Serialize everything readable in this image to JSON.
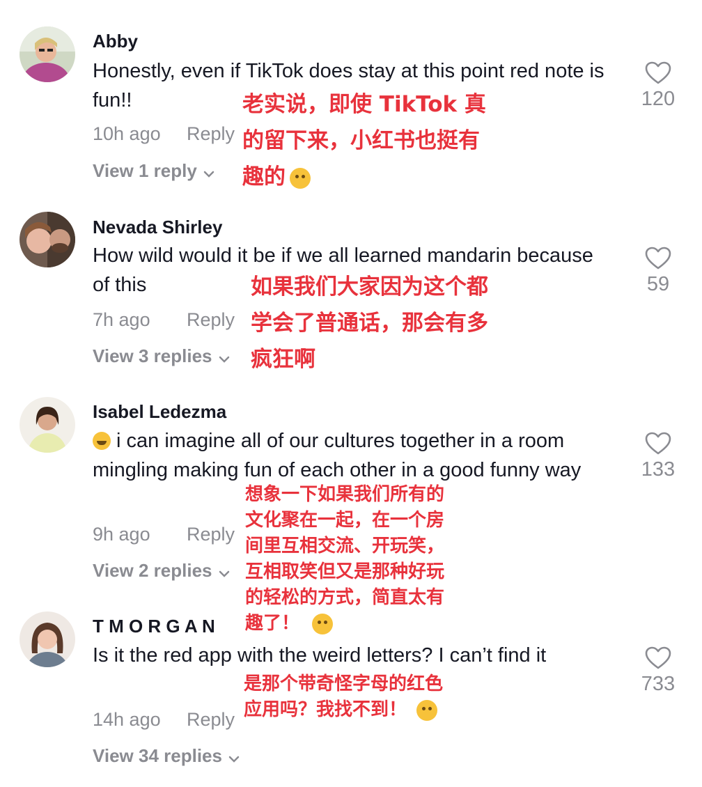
{
  "ui": {
    "reply_label": "Reply",
    "accent_red": "#e8323c",
    "muted_gray": "#8a8b91",
    "icons": {
      "like": "heart-outline-icon",
      "expand": "chevron-down-icon",
      "avatar": "user-avatar"
    }
  },
  "comments": [
    {
      "name": "Abby",
      "text": "Honestly, even if TikTok does stay at this point red note is fun!!",
      "time": "10h ago",
      "view_replies": "View 1 reply",
      "likes": "120",
      "translation": [
        "老实说，即使 TikTok 真",
        "的留下来，小红书也挺有",
        "趣的"
      ]
    },
    {
      "name": "Nevada Shirley",
      "text": "How wild would it be if we all learned mandarin because of this",
      "time": "7h ago",
      "view_replies": "View 3 replies",
      "likes": "59",
      "translation": [
        "如果我们大家因为这个都",
        "学会了普通话，那会有多",
        "疯狂啊"
      ]
    },
    {
      "name": "Isabel Ledezma",
      "text": "i can imagine all of our cultures together in a room mingling making fun of each other in a good funny way",
      "time": "9h ago",
      "view_replies": "View 2 replies",
      "likes": "133",
      "translation": [
        "想象一下如果我们所有的",
        "文化聚在一起，在一个房",
        "间里互相交流、开玩笑，",
        "互相取笑但又是那种好玩",
        "的轻松的方式，简直太有",
        "趣了！"
      ]
    },
    {
      "name": "T M O R G A N",
      "text": "Is it the red app with the weird letters? I can’t find it",
      "time": "14h ago",
      "view_replies": "View 34 replies",
      "likes": "733",
      "translation": [
        "是那个带奇怪字母的红色",
        "应用吗？我找不到！"
      ]
    }
  ]
}
